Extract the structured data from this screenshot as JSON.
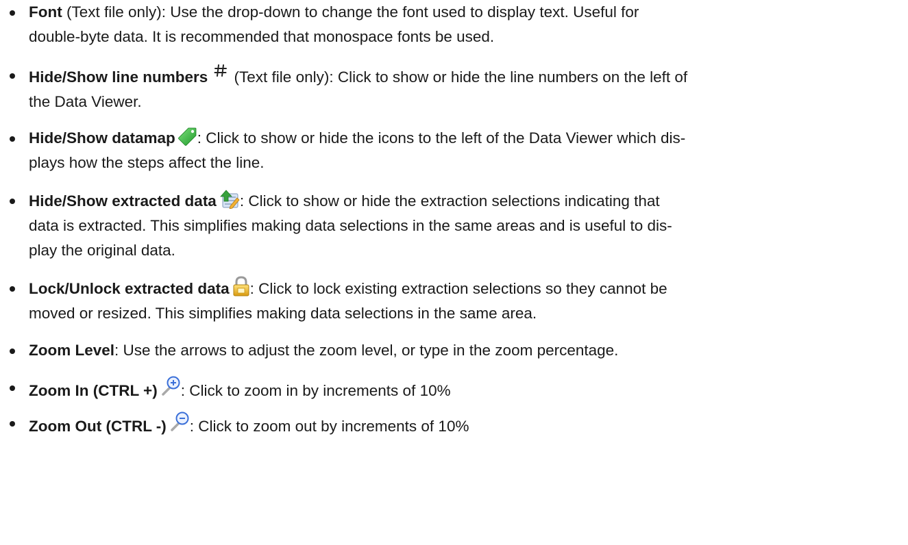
{
  "items": [
    {
      "term": "Font",
      "pre": " (Text file only): Use the drop-down to change the font used to display text. Useful for",
      "desc": "double-byte data. It is recommended that monospace fonts be used."
    },
    {
      "term": "Hide/Show line numbers",
      "icon": "hash-icon",
      "pre": " (Text file only): Click to show or hide the line numbers on the left of",
      "desc": "the Data Viewer."
    },
    {
      "term": "Hide/Show datamap",
      "icon": "tag-icon",
      "pre": ": Click to show or hide the icons to the left of the Data Viewer which dis-",
      "desc": "plays how the steps affect the line."
    },
    {
      "term": "Hide/Show extracted data",
      "icon": "extract-data-icon",
      "pre": ": Click to show or hide the extraction selections indicating that",
      "desc": "data is extracted. This simplifies making data selections in the same areas and is useful to dis-",
      "desc2": "play the original data."
    },
    {
      "term": "Lock/Unlock extracted data",
      "icon": "lock-icon",
      "pre": ": Click to lock existing extraction selections so they cannot be",
      "desc": "moved or resized. This simplifies making data selections in the same area."
    },
    {
      "term": "Zoom Level",
      "pre": ": Use the arrows to adjust the zoom level, or type in the zoom percentage."
    },
    {
      "term": "Zoom In (CTRL +)",
      "icon": "zoom-in-icon",
      "pre": ": Click to zoom in by increments of 10%"
    },
    {
      "term": "Zoom Out (CTRL -)",
      "icon": "zoom-out-icon",
      "pre": ": Click to zoom out by increments of 10%"
    }
  ],
  "colors": {
    "text": "#1a1a1a",
    "tag_green": "#3dbb3d",
    "lock_gold": "#e8b820",
    "zoom_blue": "#3a6fd8"
  }
}
